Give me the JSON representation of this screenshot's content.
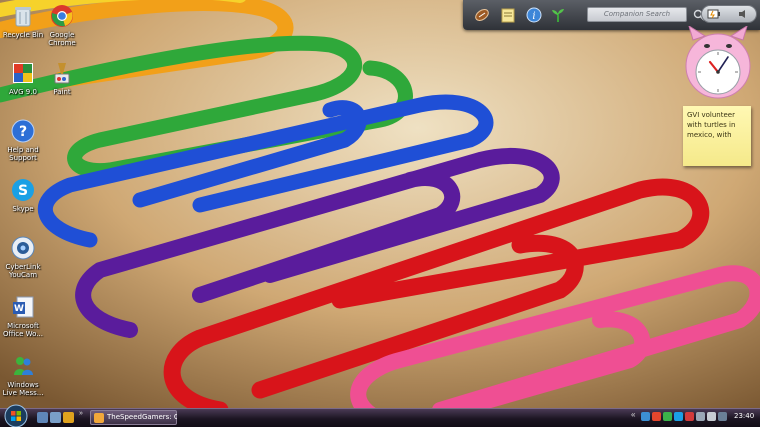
{
  "desktop": {
    "icons": [
      {
        "label": "Recycle Bin",
        "icon": "recycle-bin-icon"
      },
      {
        "label": "Google Chrome",
        "icon": "chrome-icon"
      },
      {
        "label": "AVG 9.0",
        "icon": "avg-icon"
      },
      {
        "label": "Paint",
        "icon": "paint-icon"
      },
      {
        "label": "Help and Support",
        "icon": "help-icon"
      },
      {
        "label": "Skype",
        "icon": "skype-icon"
      },
      {
        "label": "CyberLink YouCam",
        "icon": "youcam-icon"
      },
      {
        "label": "Microsoft Office Wo...",
        "icon": "word-icon"
      },
      {
        "label": "Windows Live Mess...",
        "icon": "messenger-icon"
      }
    ]
  },
  "gadget_bar": {
    "search_placeholder": "Companion Search"
  },
  "sticky_note": {
    "text": "GVI volunteer with turtles in mexico, with"
  },
  "taskbar": {
    "window_button_label": "TheSpeedGamers: C...",
    "overflow_label": "»",
    "tray_overflow_label": "«",
    "clock": "23:40"
  },
  "colors": {
    "taskbar": "#1c1522",
    "sticky": "#fff8b3",
    "clip_red": "#d8141a",
    "clip_blue": "#1f4fd6",
    "clip_purple": "#5a1c9c",
    "clip_green": "#2fa83a",
    "clip_pink": "#ef4f93"
  }
}
